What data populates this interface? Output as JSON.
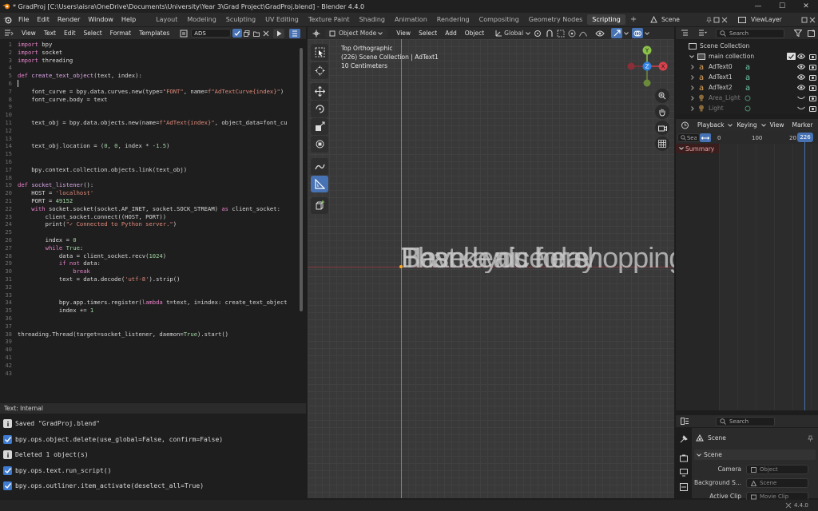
{
  "window": {
    "title": "* GradProj [C:\\Users\\aisra\\OneDrive\\Documents\\University\\Year 3\\Grad Project\\GradProj.blend] - Blender 4.4.0",
    "controls": [
      "—",
      "☐",
      "✕"
    ]
  },
  "topbar": {
    "menus": [
      "File",
      "Edit",
      "Render",
      "Window",
      "Help"
    ],
    "workspaces": [
      "Layout",
      "Modeling",
      "Sculpting",
      "UV Editing",
      "Texture Paint",
      "Shading",
      "Animation",
      "Rendering",
      "Compositing",
      "Geometry Nodes",
      "Scripting"
    ],
    "active_workspace": "Scripting",
    "add_tab": "+",
    "scene": "Scene",
    "view_layer": "ViewLayer"
  },
  "text_editor": {
    "menus": [
      "View",
      "Text",
      "Edit",
      "Select",
      "Format",
      "Templates"
    ],
    "text_name": "ADS",
    "footer": "Text: Internal",
    "lines": [
      {
        "n": "1",
        "parts": [
          [
            "kw",
            "import "
          ],
          [
            "pl",
            "bpy"
          ]
        ]
      },
      {
        "n": "2",
        "parts": [
          [
            "kw",
            "import "
          ],
          [
            "pl",
            "socket"
          ]
        ]
      },
      {
        "n": "3",
        "parts": [
          [
            "kw",
            "import "
          ],
          [
            "pl",
            "threading"
          ]
        ]
      },
      {
        "n": "4",
        "parts": []
      },
      {
        "n": "5",
        "parts": [
          [
            "kw",
            "def "
          ],
          [
            "df",
            "create_text_object"
          ],
          [
            "pl",
            "(text, index):"
          ]
        ]
      },
      {
        "n": "6",
        "parts": []
      },
      {
        "n": "7",
        "parts": [
          [
            "pl",
            "    font_curve = bpy.data.curves.new(type="
          ],
          [
            "st",
            "\"FONT\""
          ],
          [
            "pl",
            ", name="
          ],
          [
            "st",
            "f\"AdTextCurve{index}\""
          ],
          [
            "pl",
            ")"
          ]
        ]
      },
      {
        "n": "8",
        "parts": [
          [
            "pl",
            "    font_curve.body = text"
          ]
        ]
      },
      {
        "n": "9",
        "parts": []
      },
      {
        "n": "10",
        "parts": []
      },
      {
        "n": "11",
        "parts": [
          [
            "pl",
            "    text_obj = bpy.data.objects.new(name="
          ],
          [
            "st",
            "f\"AdText{index}\""
          ],
          [
            "pl",
            ", object_data=font_cu"
          ]
        ]
      },
      {
        "n": "12",
        "parts": []
      },
      {
        "n": "13",
        "parts": []
      },
      {
        "n": "14",
        "parts": [
          [
            "pl",
            "    text_obj.location = ("
          ],
          [
            "nm",
            "0"
          ],
          [
            "pl",
            ", "
          ],
          [
            "nm",
            "0"
          ],
          [
            "pl",
            ", index * -"
          ],
          [
            "nm",
            "1.5"
          ],
          [
            "pl",
            ")"
          ]
        ]
      },
      {
        "n": "15",
        "parts": []
      },
      {
        "n": "16",
        "parts": []
      },
      {
        "n": "17",
        "parts": [
          [
            "pl",
            "    bpy.context.collection.objects.link(text_obj)"
          ]
        ]
      },
      {
        "n": "18",
        "parts": []
      },
      {
        "n": "19",
        "parts": [
          [
            "kw",
            "def "
          ],
          [
            "df",
            "socket_listener"
          ],
          [
            "pl",
            "():"
          ]
        ]
      },
      {
        "n": "20",
        "parts": [
          [
            "pl",
            "    HOST = "
          ],
          [
            "st",
            "'localhost'"
          ]
        ]
      },
      {
        "n": "21",
        "parts": [
          [
            "pl",
            "    PORT = "
          ],
          [
            "nm",
            "49152"
          ]
        ]
      },
      {
        "n": "22",
        "parts": [
          [
            "kw",
            "    with "
          ],
          [
            "pl",
            "socket.socket(socket.AF_INET, socket.SOCK_STREAM) "
          ],
          [
            "kw",
            "as "
          ],
          [
            "pl",
            "client_socket:"
          ]
        ]
      },
      {
        "n": "23",
        "parts": [
          [
            "pl",
            "        client_socket.connect((HOST, PORT))"
          ]
        ]
      },
      {
        "n": "24",
        "parts": [
          [
            "pl",
            "        print("
          ],
          [
            "st",
            "\"✓ Connected to Python server.\""
          ],
          [
            "pl",
            ")"
          ]
        ]
      },
      {
        "n": "25",
        "parts": []
      },
      {
        "n": "26",
        "parts": [
          [
            "pl",
            "        index = "
          ],
          [
            "nm",
            "0"
          ]
        ]
      },
      {
        "n": "27",
        "parts": [
          [
            "kw",
            "        while "
          ],
          [
            "nm",
            "True"
          ],
          [
            "pl",
            ":"
          ]
        ]
      },
      {
        "n": "28",
        "parts": [
          [
            "pl",
            "            data = client_socket.recv("
          ],
          [
            "nm",
            "1024"
          ],
          [
            "pl",
            ")"
          ]
        ]
      },
      {
        "n": "29",
        "parts": [
          [
            "kw",
            "            if not "
          ],
          [
            "pl",
            "data:"
          ]
        ]
      },
      {
        "n": "30",
        "parts": [
          [
            "kw",
            "                break"
          ]
        ]
      },
      {
        "n": "31",
        "parts": [
          [
            "pl",
            "            text = data.decode("
          ],
          [
            "st",
            "'utf-8'"
          ],
          [
            "pl",
            ").strip()"
          ]
        ]
      },
      {
        "n": "32",
        "parts": []
      },
      {
        "n": "33",
        "parts": []
      },
      {
        "n": "34",
        "parts": [
          [
            "pl",
            "            bpy.app.timers.register("
          ],
          [
            "kw",
            "lambda "
          ],
          [
            "pl",
            "t=text, i=index: create_text_object"
          ]
        ]
      },
      {
        "n": "35",
        "parts": [
          [
            "pl",
            "            index += "
          ],
          [
            "nm",
            "1"
          ]
        ]
      },
      {
        "n": "36",
        "parts": []
      },
      {
        "n": "37",
        "parts": []
      },
      {
        "n": "38",
        "parts": [
          [
            "pl",
            "threading.Thread(target=socket_listener, daemon="
          ],
          [
            "nm",
            "True"
          ],
          [
            "pl",
            ").start()"
          ]
        ]
      },
      {
        "n": "39",
        "parts": []
      },
      {
        "n": "40",
        "parts": []
      },
      {
        "n": "41",
        "parts": []
      },
      {
        "n": "42",
        "parts": []
      },
      {
        "n": "43",
        "parts": []
      }
    ]
  },
  "info_log": {
    "rows": [
      {
        "kind": "info",
        "text": "Saved \"GradProj.blend\""
      },
      {
        "kind": "check",
        "text": "bpy.ops.object.delete(use_global=False, confirm=False)"
      },
      {
        "kind": "info",
        "text": "Deleted 1 object(s)"
      },
      {
        "kind": "check",
        "text": "bpy.ops.text.run_script()"
      },
      {
        "kind": "check",
        "text": "bpy.ops.outliner.item_activate(deselect_all=True)"
      }
    ]
  },
  "viewport": {
    "mode": "Object Mode",
    "menus": [
      "View",
      "Select",
      "Add",
      "Object"
    ],
    "transform_orientation": "Global",
    "overlay_lines": [
      "Top Orthographic",
      "(226) Scene Collection | AdText1",
      "10 Centimeters"
    ],
    "overlapping_text": [
      "Thank you for shopping",
      "Have a nice day",
      "Best deals here"
    ],
    "gizmo": {
      "y": "Y",
      "z": "Z",
      "x": "X"
    }
  },
  "outliner": {
    "search_placeholder": "Search",
    "root": "Scene Collection",
    "collection": "main collection",
    "items": [
      "AdText0",
      "AdText1",
      "AdText2",
      "Area_Light",
      "Light"
    ]
  },
  "timeline": {
    "menus": [
      "Playback",
      "Keying",
      "View",
      "Marker"
    ],
    "search_placeholder": "Search",
    "frame_labels": [
      "0",
      "100",
      "20"
    ],
    "current_frame": "226",
    "summary": "Summary"
  },
  "properties": {
    "search_placeholder": "Search",
    "context": "Scene",
    "section": "Scene",
    "camera_label": "Camera",
    "camera_value": "Object",
    "bg_label": "Background S...",
    "bg_value": "Scene",
    "clip_label": "Active Clip",
    "clip_value": "Movie Clip"
  },
  "statusbar": {
    "version": "4.4.0"
  },
  "colors": {
    "accent": "#4772b3",
    "outliner_icon": "#e0a660",
    "data_icon": "#6ec6a5",
    "x_axis": "#d9424d",
    "y_axis": "#8bc34a",
    "z_axis": "#2f83e4"
  }
}
